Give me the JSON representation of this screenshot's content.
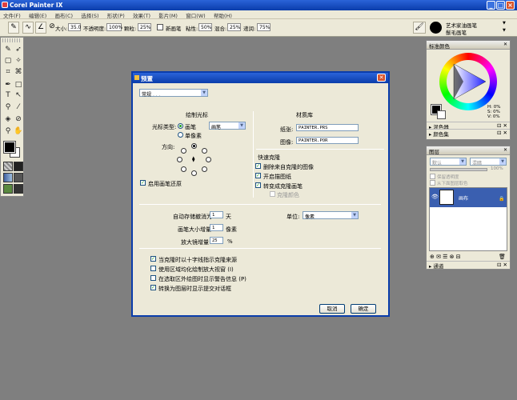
{
  "app": {
    "title": "Corel Painter IX"
  },
  "menu": [
    "文件(F)",
    "编辑(E)",
    "画布(C)",
    "选择(S)",
    "形状(P)",
    "效果(T)",
    "影片(M)",
    "窗口(W)",
    "帮助(H)"
  ],
  "propbar": {
    "size_label": "大小:",
    "size_value": "35.0",
    "opacity_label": "不透明度:",
    "opacity_value": "100%",
    "grain_label": "颗粒:",
    "grain_value": "25%",
    "newbrush_label": "新画笔",
    "resat_label": "粘性:",
    "resat_value": "50%",
    "bleed_label": "混合:",
    "bleed_value": "25%",
    "jitter_label": "递润:",
    "jitter_value": "75%",
    "brush_category": "艺术家油画笔",
    "brush_variant": "鬃毛画笔"
  },
  "panels": {
    "colors_title": "标准颜色",
    "hsv": {
      "h": "H: 0%",
      "s": "S: 0%",
      "v": "V: 0%"
    },
    "mixer": "混色器",
    "color_sets": "颜色集",
    "layers_title": "图层",
    "layers_composite": "默认",
    "layers_mode": "混暗",
    "layers_opacity": "100%",
    "preserve": "保留透明度",
    "pick_under": "从下面图层取色",
    "canvas_layer": "画布",
    "channels": "通道"
  },
  "dialog": {
    "title": "预置",
    "category": "常规",
    "cursor_section": "绘制光标",
    "cursor_type_label": "光标类型:",
    "cursor_brush": "画笔",
    "cursor_brush_dd": "画笔",
    "cursor_single": "单像素",
    "direction_label": "方向:",
    "enable_ghost": "启用画笔还原",
    "library_section": "材质库",
    "paper_label": "纸张:",
    "paper_value": "PAINTER.PRS",
    "pattern_label": "图像:",
    "pattern_value": "PAINTER.POR",
    "quick_clone": "快速克隆",
    "qc_delete": "删除来自克隆的图像",
    "qc_tracing": "开启描图纸",
    "qc_clone_brush": "转变成克隆画笔",
    "qc_clone_color": "克隆颜色",
    "autosave_label": "自动存储撤消为",
    "autosave_value": "1",
    "autosave_unit": "天",
    "units_label": "单位:",
    "units_value": "像素",
    "brush_size_label": "画笔大小增量",
    "brush_size_value": "1",
    "brush_size_unit": "像素",
    "zoom_label": "放大镜增量",
    "zoom_value": "25",
    "zoom_unit": "%",
    "opt1": "当克隆时以十字线指示克隆来源",
    "opt2": "使用区域均化绘制放大视窗 (I)",
    "opt3": "在选取区外绘图时显示警告信息 (P)",
    "opt4": "转换为图层时显示提交对话框",
    "cancel": "取消",
    "ok": "确定"
  }
}
